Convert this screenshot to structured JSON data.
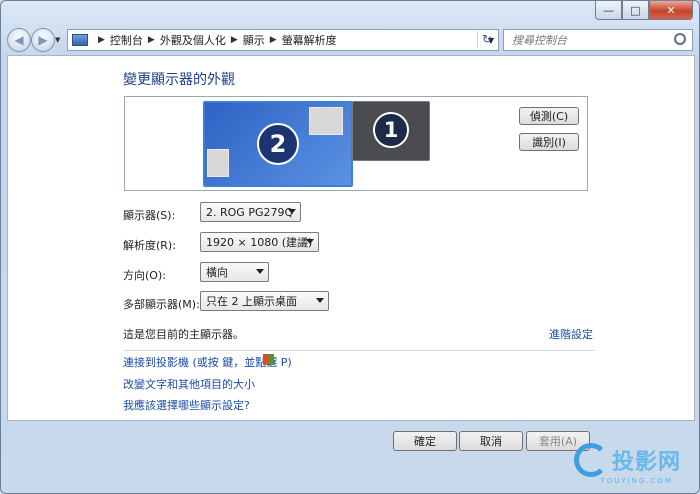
{
  "window": {
    "min_glyph": "—",
    "max_glyph": "□",
    "close_glyph": "✕"
  },
  "nav": {
    "back_glyph": "◀",
    "forward_glyph": "▶"
  },
  "breadcrumb": [
    "控制台",
    "外觀及個人化",
    "顯示",
    "螢幕解析度"
  ],
  "search": {
    "placeholder": "搜尋控制台"
  },
  "page": {
    "title": "變更顯示器的外觀",
    "detect_button": "偵測(C)",
    "identify_button": "識別(I)",
    "monitor_primary_number": "2",
    "monitor_secondary_number": "1",
    "display_label": "顯示器(S):",
    "display_value": "2. ROG PG279Q",
    "resolution_label": "解析度(R):",
    "resolution_value": "1920 × 1080 (建議)",
    "orientation_label": "方向(O):",
    "orientation_value": "橫向",
    "multi_label": "多部顯示器(M):",
    "multi_value": "只在 2 上顯示桌面",
    "primary_text": "這是您目前的主顯示器。",
    "advanced_link": "進階設定",
    "link_projector": "連接到投影機 (或按   鍵，並點選 P)",
    "link_text_size": "改變文字和其他項目的大小",
    "link_which": "我應該選擇哪些顯示設定?"
  },
  "footer": {
    "ok": "確定",
    "cancel": "取消",
    "apply": "套用(A)"
  },
  "watermark": {
    "text": "投影网",
    "sub": "TOUYING.COM"
  },
  "colors": {
    "link": "#1c4ca4",
    "title": "#1a3e88",
    "monitor_selected": "#3c80d6"
  }
}
